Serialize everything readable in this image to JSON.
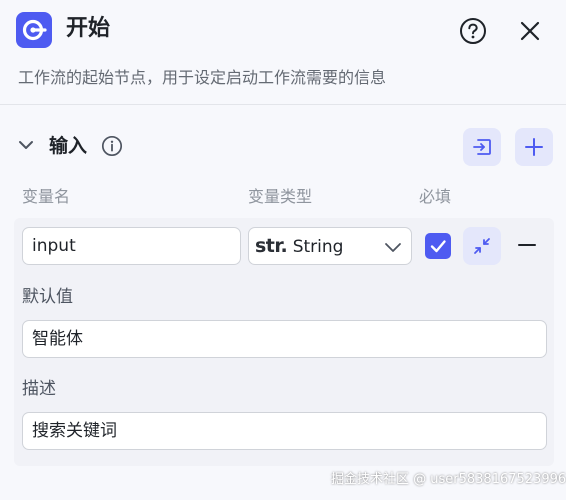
{
  "header": {
    "title": "开始",
    "logo_icon": "node-start-icon",
    "help_icon": "question-circle-icon",
    "close_icon": "close-icon",
    "description": "工作流的起始节点，用于设定启动工作流需要的信息"
  },
  "inputs_section": {
    "title": "输入",
    "expanded": true,
    "columns": {
      "name": "变量名",
      "type": "变量类型",
      "required": "必填"
    },
    "variables": [
      {
        "name": "input",
        "type_badge": "str.",
        "type_name": "String",
        "required": true,
        "default_label": "默认值",
        "default_value": "智能体",
        "description_label": "描述",
        "description_value": "搜索关键词"
      }
    ]
  },
  "colors": {
    "accent": "#4e5bf1",
    "accent_light": "#e4e7fb",
    "text_primary": "#1f2329",
    "text_secondary": "#646a73",
    "text_muted": "#8f959e",
    "background": "#f7f8fc"
  },
  "watermark": "掘金技术社区 @ user5838167523996"
}
